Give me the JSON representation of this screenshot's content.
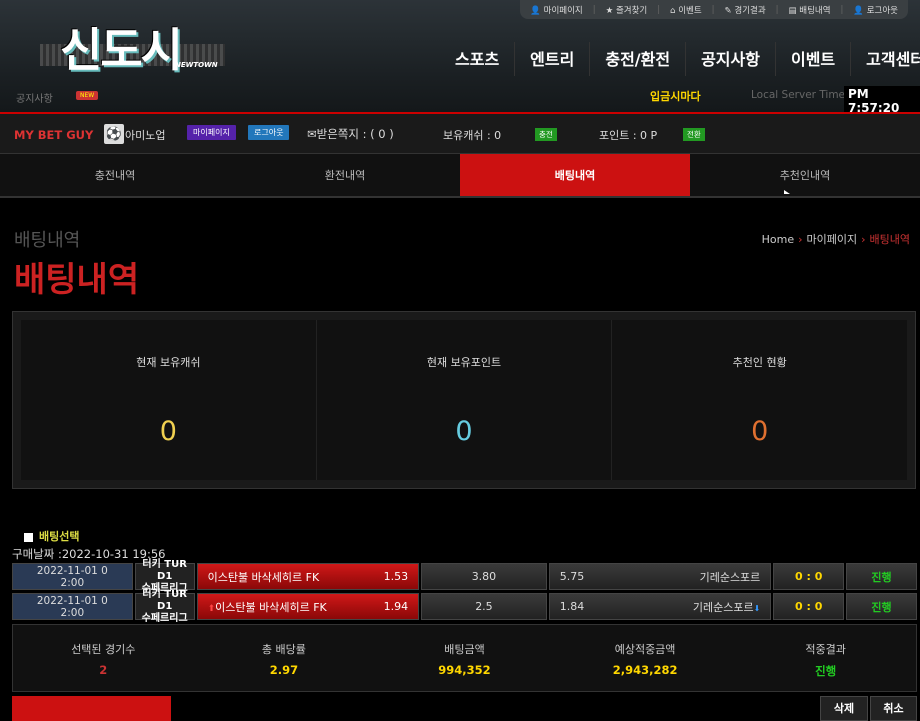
{
  "toplinks": [
    "마이페이지",
    "즐겨찾기",
    "이벤트",
    "경기결과",
    "배팅내역",
    "로그아웃"
  ],
  "logo": {
    "text": "신도시",
    "sub": "NEWTOWN"
  },
  "nav": [
    "스포츠",
    "엔트리",
    "충전/환전",
    "공지사항",
    "이벤트",
    "고객센터"
  ],
  "notice": {
    "label": "공지사항",
    "badge": "NEW"
  },
  "slogan": "입금시마다",
  "server": {
    "label": "Local Server Time",
    "time": "PM 7:57:20"
  },
  "user": {
    "brand": "MY BET GUY",
    "name": "아미노업",
    "mypage": "마이페이지",
    "logout": "로그아웃",
    "messages": "받은쪽지 : ( 0 )",
    "cash": "보유캐쉬 : 0",
    "charge": "충전",
    "points": "포인트 : 0 P",
    "convert": "전환"
  },
  "tabs": [
    "충전내역",
    "환전내역",
    "배팅내역",
    "추천인내역"
  ],
  "page": {
    "title_small": "배팅내역",
    "title_big": "배팅내역"
  },
  "breadcrumb": {
    "home": "Home",
    "mypage": "마이페이지",
    "current": "배팅내역"
  },
  "stats": [
    {
      "label": "현재 보유캐쉬",
      "value": "0",
      "color": "#f0d050"
    },
    {
      "label": "현재 보유포인트",
      "value": "0",
      "color": "#66cce0"
    },
    {
      "label": "추천인 현황",
      "value": "0",
      "color": "#e07030"
    }
  ],
  "bet_select": "배팅선택",
  "purchase_date": "구매날짜 :2022-10-31 19:56",
  "bets": [
    {
      "date1": "2022-11-01 0",
      "date2": "2:00",
      "league1": "터키 TUR D1",
      "league2": "수페르리그",
      "home": "이스탄불 바삭세히르 FK",
      "home_odds": "1.53",
      "draw": "3.80",
      "away_odds": "5.75",
      "away": "기레순스포르",
      "score": "0 : 0",
      "status": "진행"
    },
    {
      "date1": "2022-11-01 0",
      "date2": "2:00",
      "league1": "터키 TUR D1",
      "league2": "수페르리그",
      "home": "이스탄불 바삭세히르 FK",
      "home_odds": "1.94",
      "draw": "2.5",
      "away_odds": "1.84",
      "away": "기레순스포르",
      "score": "0 : 0",
      "status": "진행"
    }
  ],
  "summary": [
    {
      "label": "선택된 경기수",
      "value": "2",
      "color": "#cc3333"
    },
    {
      "label": "총 배당률",
      "value": "2.97",
      "color": "#ffd700"
    },
    {
      "label": "배팅금액",
      "value": "994,352",
      "color": "#ffd700"
    },
    {
      "label": "예상적중금액",
      "value": "2,943,282",
      "color": "#ffd700"
    },
    {
      "label": "적중결과",
      "value": "진행",
      "color": "#22cc22"
    }
  ],
  "buttons": {
    "delete": "삭제",
    "cancel": "취소"
  }
}
